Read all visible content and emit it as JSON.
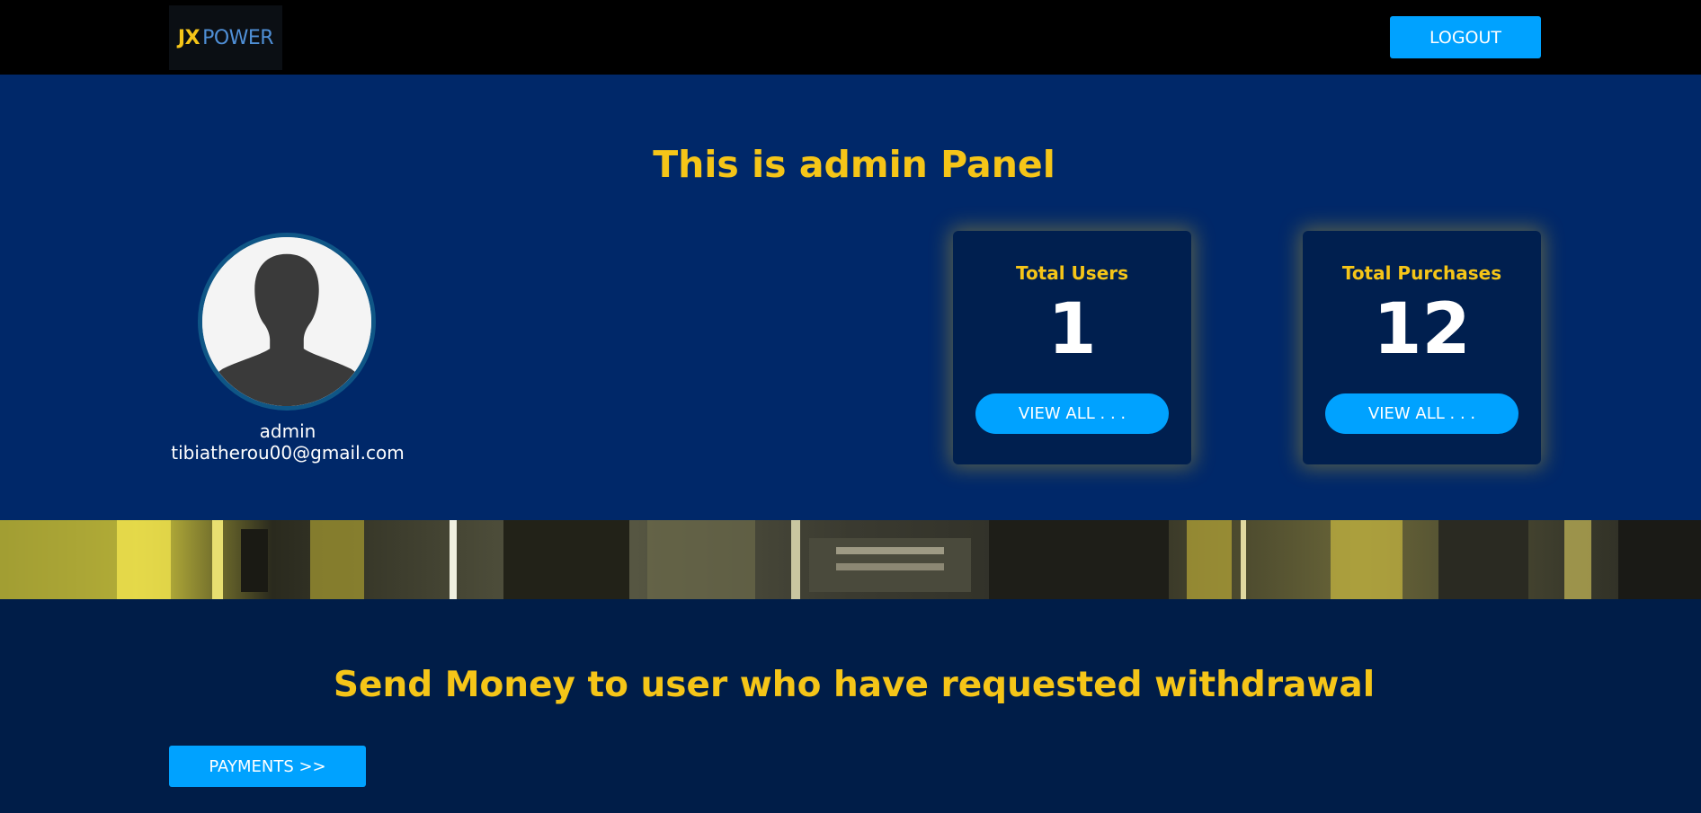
{
  "header": {
    "logo_left": "JX",
    "logo_right": "POWER",
    "logout_label": "LOGOUT"
  },
  "hero": {
    "title": "This is admin Panel",
    "profile": {
      "name": "admin",
      "email": "tibiatherou00@gmail.com",
      "avatar_icon": "user-silhouette-icon"
    },
    "stats": [
      {
        "label": "Total Users",
        "value": "1",
        "button_label": "VIEW ALL . . ."
      },
      {
        "label": "Total Purchases",
        "value": "12",
        "button_label": "VIEW ALL . . ."
      }
    ]
  },
  "withdrawal": {
    "title": "Send Money to user who have requested withdrawal",
    "payments_label": "PAYMENTS >>"
  },
  "colors": {
    "accent": "#00a2ff",
    "highlight": "#f5c518",
    "hero_bg": "#002869",
    "section_bg": "#001d48",
    "topbar_bg": "#000000"
  }
}
